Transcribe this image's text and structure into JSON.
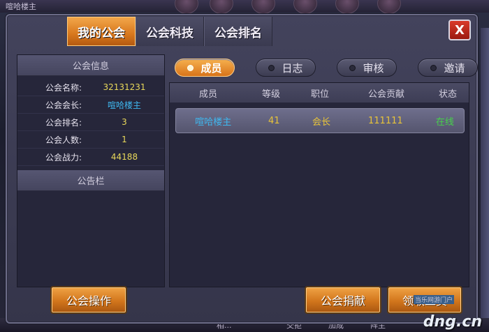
{
  "background": {
    "top_left_text": "喧哈楼主",
    "bottom_texts": [
      "相...",
      "交拒",
      "加成",
      "阵主"
    ]
  },
  "tabs": [
    {
      "label": "我的公会",
      "active": true
    },
    {
      "label": "公会科技",
      "active": false
    },
    {
      "label": "公会排名",
      "active": false
    }
  ],
  "close_label": "X",
  "guild_info": {
    "header": "公会信息",
    "rows": [
      {
        "key": "公会名称:",
        "value": "32131231"
      },
      {
        "key": "公会会长:",
        "value": "喧哈楼主"
      },
      {
        "key": "公会排名:",
        "value": "3"
      },
      {
        "key": "公会人数:",
        "value": "1"
      },
      {
        "key": "公会战力:",
        "value": "44188"
      }
    ]
  },
  "notice_board": {
    "header": "公告栏"
  },
  "filters": [
    {
      "label": "成员",
      "active": true
    },
    {
      "label": "日志",
      "active": false
    },
    {
      "label": "审核",
      "active": false
    },
    {
      "label": "邀请",
      "active": false
    }
  ],
  "member_table": {
    "columns": [
      "成员",
      "等级",
      "职位",
      "公会贡献",
      "状态"
    ],
    "rows": [
      {
        "name": "喧哈楼主",
        "level": "41",
        "position": "会长",
        "contribution": "111111",
        "status": "在线"
      }
    ]
  },
  "buttons": {
    "guild_ops": "公会操作",
    "donate": "公会捐献",
    "collect": "领取工资"
  },
  "watermark": {
    "main": "dng.cn",
    "sub": "当乐网游门户"
  },
  "colors": {
    "accent_orange": "#d8781d",
    "name_blue": "#3fb8f0",
    "value_yellow": "#e8c43a",
    "online_green": "#46d24a",
    "close_red": "#d93a2a"
  }
}
